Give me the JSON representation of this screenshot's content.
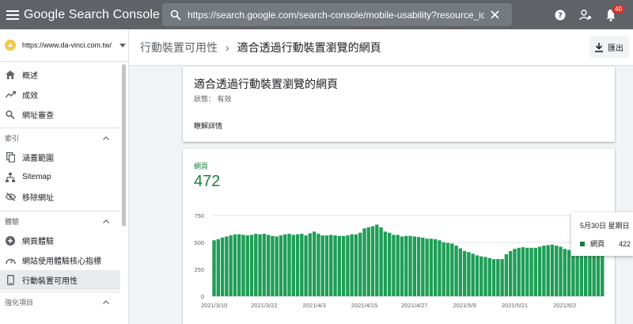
{
  "app": {
    "title": "Google Search Console"
  },
  "urlbar": {
    "url": "https://search.google.com/search-console/mobile-usability?resource_id=https%3A%2F"
  },
  "topbar": {
    "notification_count": "40"
  },
  "sidebar": {
    "property": "https://www.da-vinci.com.tw/",
    "items_top": [
      {
        "label": "概述",
        "icon": "home-icon"
      },
      {
        "label": "成效",
        "icon": "trending-icon"
      },
      {
        "label": "網址審查",
        "icon": "search-icon"
      }
    ],
    "section_index": {
      "label": "索引"
    },
    "items_index": [
      {
        "label": "涵蓋範圍",
        "icon": "copy-icon"
      },
      {
        "label": "Sitemap",
        "icon": "sitemap-icon"
      },
      {
        "label": "移除網址",
        "icon": "eye-off-icon"
      }
    ],
    "section_experience": {
      "label": "體驗"
    },
    "items_experience": [
      {
        "label": "網頁體驗",
        "icon": "add-circle-icon"
      },
      {
        "label": "網站使用體驗核心指標",
        "icon": "speed-icon"
      },
      {
        "label": "行動裝置可用性",
        "icon": "phone-icon"
      }
    ],
    "section_enhancements": {
      "label": "強化項目"
    }
  },
  "header": {
    "crumb_parent": "行動裝置可用性",
    "crumb_current": "適合透過行動裝置瀏覽的網頁",
    "export_label": "匯出"
  },
  "summary_card": {
    "title": "適合透過行動裝置瀏覽的網頁",
    "status": "狀態：   有效",
    "learn_more": "瞭解詳情"
  },
  "metric": {
    "label": "網頁",
    "value": "472"
  },
  "colors": {
    "accent_green": "#188038",
    "bar_green": "#1e9e56",
    "topbar": "#5f6368"
  },
  "tooltip": {
    "date": "5月30日 星期日",
    "series": "網頁",
    "value": "422"
  },
  "chart_data": {
    "type": "bar",
    "ylim": [
      0,
      750
    ],
    "yticks": [
      "0",
      "250",
      "500",
      "750"
    ],
    "xticks": [
      {
        "index": 0,
        "label": "2021/3/10"
      },
      {
        "index": 12,
        "label": "2021/3/22"
      },
      {
        "index": 24,
        "label": "2021/4/3"
      },
      {
        "index": 36,
        "label": "2021/4/15"
      },
      {
        "index": 48,
        "label": "2021/4/27"
      },
      {
        "index": 60,
        "label": "2021/5/9"
      },
      {
        "index": 72,
        "label": "2021/5/21"
      },
      {
        "index": 84,
        "label": "2021/6/2"
      }
    ],
    "series": [
      {
        "values": [
          520,
          530,
          545,
          555,
          565,
          575,
          575,
          570,
          565,
          570,
          580,
          575,
          580,
          570,
          560,
          555,
          565,
          575,
          580,
          570,
          575,
          580,
          565,
          585,
          600,
          580,
          565,
          565,
          570,
          565,
          560,
          560,
          565,
          575,
          575,
          590,
          630,
          640,
          650,
          665,
          640,
          600,
          590,
          570,
          570,
          555,
          560,
          560,
          555,
          550,
          545,
          535,
          535,
          530,
          520,
          500,
          495,
          490,
          470,
          445,
          420,
          410,
          395,
          380,
          370,
          365,
          355,
          345,
          345,
          345,
          390,
          420,
          440,
          450,
          455,
          450,
          450,
          450,
          460,
          470,
          475,
          480,
          470,
          460,
          440,
          430,
          425,
          425,
          430,
          440,
          430,
          425,
          420,
          422
        ]
      }
    ]
  }
}
